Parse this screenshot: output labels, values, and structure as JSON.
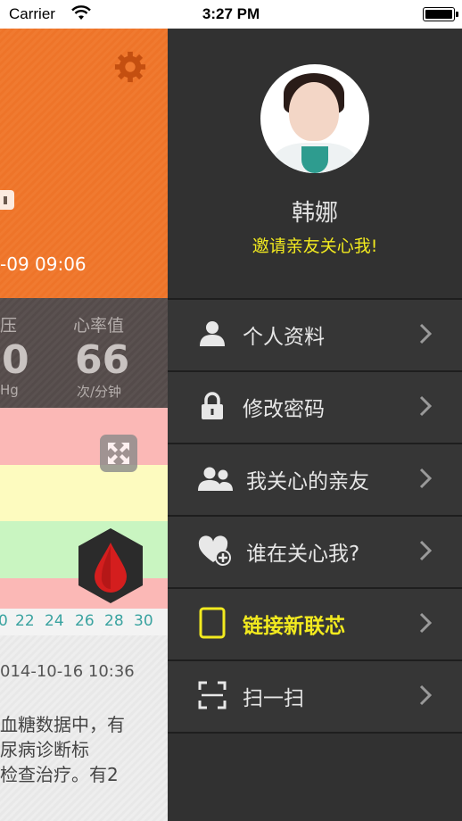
{
  "status_bar": {
    "carrier": "Carrier",
    "time": "3:27 PM"
  },
  "main": {
    "timestamp": "-09 09:06",
    "stats": {
      "pressure_label": "压",
      "pressure_value": "0",
      "pressure_unit": "Hg",
      "heart_rate_label": "心率值",
      "heart_rate_value": "66",
      "heart_rate_unit": "次/分钟"
    },
    "zones": [
      {
        "color": "#fbb8b6"
      },
      {
        "color": "#fdfbbf"
      },
      {
        "color": "#c9f5c1"
      },
      {
        "color": "#fbb8b6"
      }
    ],
    "axis_ticks": [
      "0",
      "22",
      "24",
      "26",
      "28",
      "30"
    ],
    "record_date": "014-10-16 10:36",
    "record_text": [
      "血糖数据中，有",
      "尿病诊断标",
      "检查治疗。有2"
    ]
  },
  "menu": {
    "user_name": "韩娜",
    "invite_text": "邀请亲友关心我!",
    "items": [
      {
        "label": "个人资料",
        "icon": "person-icon"
      },
      {
        "label": "修改密码",
        "icon": "lock-icon"
      },
      {
        "label": "我关心的亲友",
        "icon": "people-icon"
      },
      {
        "label": "谁在关心我?",
        "icon": "heart-plus-icon"
      },
      {
        "label": "链接新联芯",
        "icon": "tablet-icon",
        "highlight": true
      },
      {
        "label": "扫一扫",
        "icon": "scan-icon"
      }
    ]
  },
  "colors": {
    "accent_yellow": "#f2ea1f",
    "orange": "#f07a30",
    "menu_bg": "#313131"
  }
}
